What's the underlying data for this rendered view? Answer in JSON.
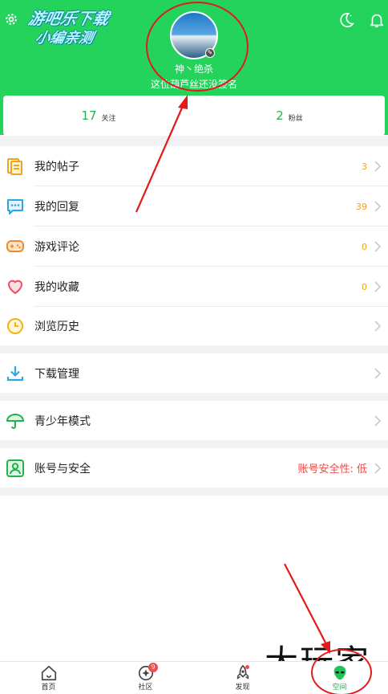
{
  "header": {
    "watermark_line1": "游吧乐下载",
    "watermark_line2": "小编亲测",
    "username": "神丶绝杀",
    "signature": "这位葫芦丝还没签名",
    "colors": {
      "header_bg": "#23d35c",
      "accent_green": "#23b24f",
      "annotation_red": "#e21a1a"
    }
  },
  "stats": {
    "following_count": "17",
    "following_label": "关注",
    "fans_count": "2",
    "fans_label": "粉丝"
  },
  "menu": {
    "posts": {
      "label": "我的帖子",
      "count": "3",
      "icon": "document-icon"
    },
    "replies": {
      "label": "我的回复",
      "count": "39",
      "icon": "chat-icon"
    },
    "reviews": {
      "label": "游戏评论",
      "count": "0",
      "icon": "gamepad-icon"
    },
    "favorites": {
      "label": "我的收藏",
      "count": "0",
      "icon": "heart-icon"
    },
    "history": {
      "label": "浏览历史",
      "icon": "clock-icon"
    },
    "downloads": {
      "label": "下载管理",
      "icon": "download-icon"
    },
    "youth": {
      "label": "青少年模式",
      "icon": "umbrella-icon"
    },
    "account": {
      "label": "账号与安全",
      "security_status": "账号安全性: 低",
      "icon": "person-card-icon"
    }
  },
  "tabbar": {
    "home": "首页",
    "community": "社区",
    "community_badge": "9",
    "discover": "发现",
    "space": "空间"
  },
  "brand": {
    "text": "大玩家"
  }
}
